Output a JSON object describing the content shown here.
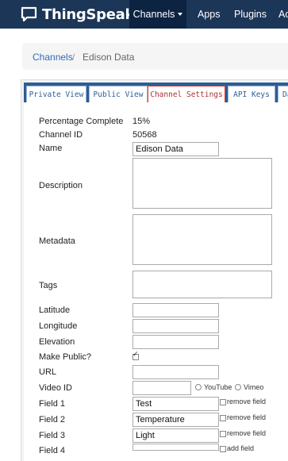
{
  "navbar": {
    "brand": "ThingSpeak",
    "items": [
      {
        "label": "Channels"
      },
      {
        "label": "Apps"
      },
      {
        "label": "Plugins"
      },
      {
        "label": "Ac"
      }
    ]
  },
  "breadcrumb": {
    "link": "Channels",
    "separator": "/",
    "current": "Edison Data"
  },
  "tabs": [
    {
      "label": "Private View"
    },
    {
      "label": "Public View"
    },
    {
      "label": "Channel Settings"
    },
    {
      "label": "API Keys"
    },
    {
      "label": "Da"
    }
  ],
  "form": {
    "percentage_label": "Percentage Complete",
    "percentage_value": "15%",
    "channel_id_label": "Channel ID",
    "channel_id_value": "50568",
    "name_label": "Name",
    "name_value": "Edison Data",
    "description_label": "Description",
    "metadata_label": "Metadata",
    "tags_label": "Tags",
    "latitude_label": "Latitude",
    "longitude_label": "Longitude",
    "elevation_label": "Elevation",
    "make_public_label": "Make Public?",
    "url_label": "URL",
    "video_id_label": "Video ID",
    "youtube_label": "YouTube",
    "vimeo_label": "Vimeo",
    "field1_label": "Field 1",
    "field1_value": "Test",
    "field2_label": "Field 2",
    "field2_value": "Temperature",
    "field3_label": "Field 3",
    "field3_value": "Light",
    "field4_label": "Field 4",
    "remove_field": "remove field",
    "add_field": "add field"
  },
  "colors": {
    "navbar": "#1c3657",
    "navbar_active": "#0c2442",
    "tabbar": "#2c5d95",
    "active_tab": "#b03030",
    "link": "#2a6fb3"
  }
}
